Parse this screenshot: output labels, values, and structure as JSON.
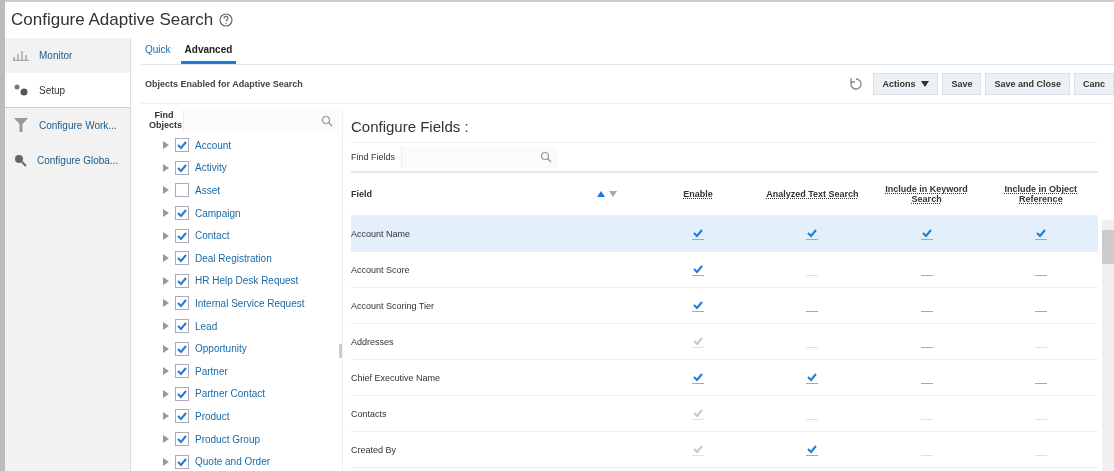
{
  "window": {
    "title": "Configure Adaptive Search"
  },
  "sidebar": {
    "items": [
      {
        "label": "Monitor",
        "selected": false
      },
      {
        "label": "Setup",
        "selected": true
      },
      {
        "label": "Configure Work...",
        "selected": false
      },
      {
        "label": "Configure Globa...",
        "selected": false
      }
    ]
  },
  "tabs": [
    {
      "label": "Quick",
      "selected": false
    },
    {
      "label": "Advanced",
      "selected": true
    }
  ],
  "panel_title": "Objects Enabled for Adaptive Search",
  "toolbar": {
    "buttons": [
      {
        "label": "Actions",
        "kind": "menu"
      },
      {
        "label": "Save",
        "kind": "plain"
      },
      {
        "label": "Save and Close",
        "kind": "plain"
      },
      {
        "label": "Canc",
        "kind": "plain"
      }
    ]
  },
  "objects": {
    "search_label": "Find Objects",
    "items": [
      {
        "label": "Account",
        "checked": true
      },
      {
        "label": "Activity",
        "checked": true
      },
      {
        "label": "Asset",
        "checked": false
      },
      {
        "label": "Campaign",
        "checked": true
      },
      {
        "label": "Contact",
        "checked": true
      },
      {
        "label": "Deal Registration",
        "checked": true
      },
      {
        "label": "HR Help Desk Request",
        "checked": true
      },
      {
        "label": "Internal Service Request",
        "checked": true
      },
      {
        "label": "Lead",
        "checked": true
      },
      {
        "label": "Opportunity",
        "checked": true
      },
      {
        "label": "Partner",
        "checked": true
      },
      {
        "label": "Partner Contact",
        "checked": true
      },
      {
        "label": "Product",
        "checked": true
      },
      {
        "label": "Product Group",
        "checked": true
      },
      {
        "label": "Quote and Order",
        "checked": true
      }
    ]
  },
  "fields": {
    "title": "Configure Fields :",
    "search_label": "Find Fields",
    "columns": [
      "Field",
      "Enable",
      "Analyzed Text Search",
      "Include in Keyword Search",
      "Include in Object Reference"
    ],
    "rows": [
      {
        "field": "Account Name",
        "selected": true,
        "cells": [
          {
            "checked": true,
            "disabled": false
          },
          {
            "checked": true,
            "disabled": false
          },
          {
            "checked": true,
            "disabled": false
          },
          {
            "checked": true,
            "disabled": false
          }
        ]
      },
      {
        "field": "Account Score",
        "selected": false,
        "cells": [
          {
            "checked": true,
            "disabled": false
          },
          {
            "checked": false,
            "disabled": true
          },
          {
            "checked": false,
            "disabled": false
          },
          {
            "checked": false,
            "disabled": false
          }
        ]
      },
      {
        "field": "Account Scoring Tier",
        "selected": false,
        "cells": [
          {
            "checked": true,
            "disabled": false
          },
          {
            "checked": false,
            "disabled": false
          },
          {
            "checked": false,
            "disabled": false
          },
          {
            "checked": false,
            "disabled": false
          }
        ]
      },
      {
        "field": "Addresses",
        "selected": false,
        "cells": [
          {
            "checked": true,
            "disabled": true
          },
          {
            "checked": false,
            "disabled": true
          },
          {
            "checked": false,
            "disabled": false
          },
          {
            "checked": false,
            "disabled": true
          }
        ]
      },
      {
        "field": "Chief Executive Name",
        "selected": false,
        "cells": [
          {
            "checked": true,
            "disabled": false
          },
          {
            "checked": true,
            "disabled": false
          },
          {
            "checked": false,
            "disabled": false
          },
          {
            "checked": false,
            "disabled": false
          }
        ]
      },
      {
        "field": "Contacts",
        "selected": false,
        "cells": [
          {
            "checked": true,
            "disabled": true
          },
          {
            "checked": false,
            "disabled": true
          },
          {
            "checked": false,
            "disabled": true
          },
          {
            "checked": false,
            "disabled": true
          }
        ]
      },
      {
        "field": "Created By",
        "selected": false,
        "cells": [
          {
            "checked": true,
            "disabled": true
          },
          {
            "checked": true,
            "disabled": false
          },
          {
            "checked": false,
            "disabled": true
          },
          {
            "checked": false,
            "disabled": true
          }
        ]
      }
    ]
  }
}
